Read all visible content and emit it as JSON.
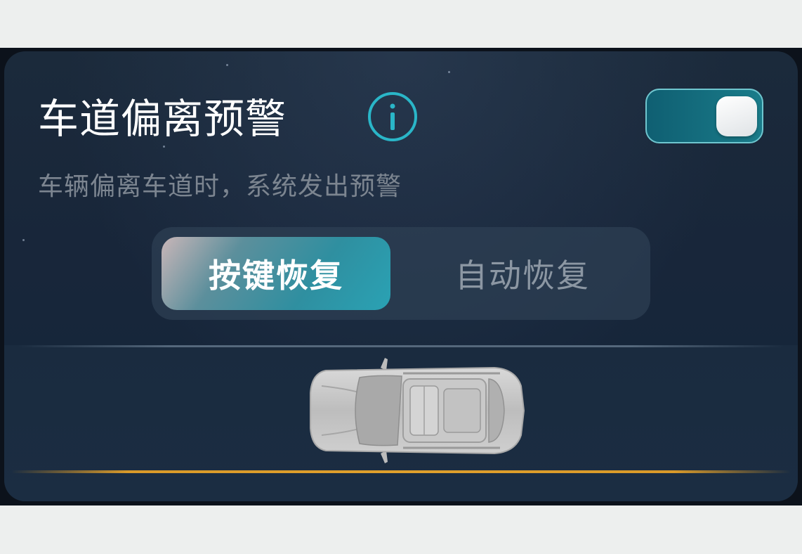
{
  "lane_departure": {
    "title": "车道偏离预警",
    "description": "车辆偏离车道时，系统发出预警",
    "info_icon": "info-icon",
    "toggle": {
      "on": true
    },
    "recovery_modes": [
      {
        "label": "按键恢复",
        "selected": true
      },
      {
        "label": "自动恢复",
        "selected": false
      }
    ],
    "illustration": "car-top-view"
  },
  "colors": {
    "accent": "#2aa2b4",
    "info_icon": "#2ab6c8",
    "lane_marking": "#e0a02c",
    "card_bg": "#18263a"
  }
}
